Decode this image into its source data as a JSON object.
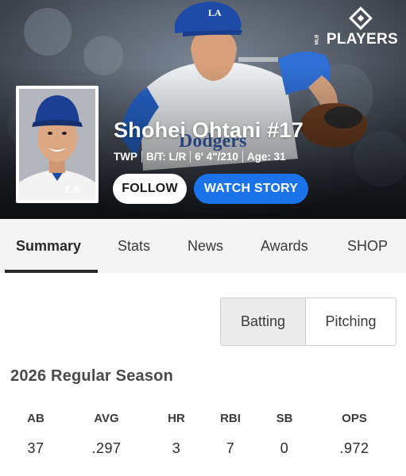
{
  "brand": {
    "logo_text": "PLAYERS",
    "logo_prefix": "MLB"
  },
  "player": {
    "name": "Shohei Ohtani #17",
    "bio": [
      "TWP",
      "B/T: L/R",
      "6' 4\"/210",
      "Age: 31"
    ],
    "team_cap_logo": "LA"
  },
  "actions": {
    "follow_label": "FOLLOW",
    "watch_label": "WATCH STORY"
  },
  "tabs": [
    {
      "label": "Summary",
      "active": true
    },
    {
      "label": "Stats",
      "active": false
    },
    {
      "label": "News",
      "active": false
    },
    {
      "label": "Awards",
      "active": false
    },
    {
      "label": "SHOP",
      "active": false
    }
  ],
  "toggle": {
    "options": [
      {
        "label": "Batting",
        "active": true
      },
      {
        "label": "Pitching",
        "active": false
      }
    ]
  },
  "season": {
    "title": "2026 Regular Season",
    "headers": [
      "AB",
      "AVG",
      "HR",
      "RBI",
      "SB",
      "OPS"
    ],
    "values": [
      "37",
      ".297",
      "3",
      "7",
      "0",
      ".972"
    ]
  },
  "colors": {
    "accent_blue": "#1a73e8",
    "dodger_blue": "#1e3f8f",
    "hero_dark": "#1e2126"
  }
}
